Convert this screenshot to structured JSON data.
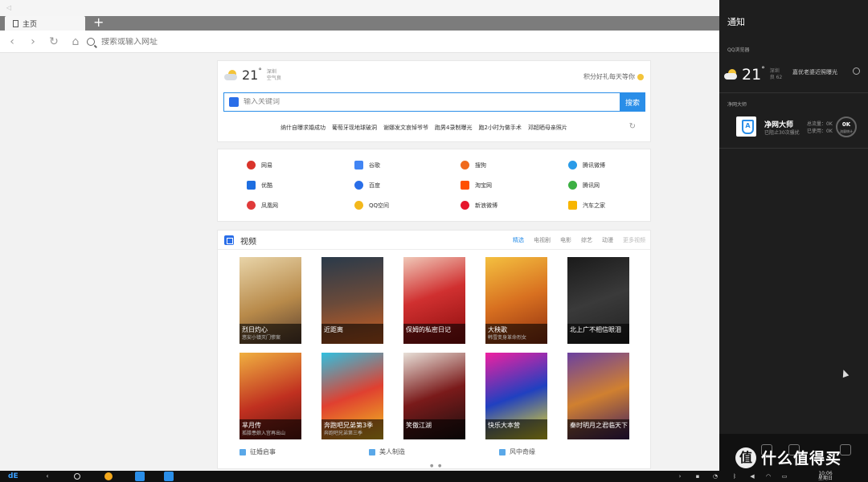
{
  "browser": {
    "tab_label": "主页",
    "new_tab": "+",
    "address_placeholder": "搜索或输入网址"
  },
  "search_card": {
    "weather": {
      "temp": "21",
      "deg": "°",
      "city": "深圳",
      "air": "空气良"
    },
    "reward": "积分好礼每天等你",
    "search_placeholder": "输入关键词",
    "search_button": "搜索",
    "hot_words": [
      "纳什自曝求婚成功",
      "葡萄牙现地球破洞",
      "谢娜发文哀悼爷爷",
      "跑男4录制曝光",
      "跑2小时为做手术",
      "邓超晒母亲照片"
    ]
  },
  "sites": [
    [
      "网易",
      "谷歌",
      "搜狗",
      "腾讯微博"
    ],
    [
      "优酷",
      "百度",
      "淘宝网",
      "腾讯网"
    ],
    [
      "凤凰网",
      "QQ空间",
      "新浪微博",
      "汽车之家"
    ]
  ],
  "video": {
    "title": "视频",
    "tabs": [
      "精选",
      "电视剧",
      "电影",
      "综艺",
      "动漫",
      "更多视频"
    ],
    "posters": [
      {
        "title": "烈日灼心",
        "sub": "悠安小镇灭门惨案"
      },
      {
        "title": "近距离",
        "sub": ""
      },
      {
        "title": "保姆的私密日记",
        "sub": ""
      },
      {
        "title": "大秧歌",
        "sub": "韩雪变身革命烈女"
      },
      {
        "title": "北上广不相信眼泪",
        "sub": ""
      },
      {
        "title": "芈月传",
        "sub": "孤膝患娘入宫再出山"
      },
      {
        "title": "奔跑吧兄弟第3季",
        "sub": "奔跑吧兄弟第三季"
      },
      {
        "title": "笑傲江湖",
        "sub": ""
      },
      {
        "title": "快乐大本营",
        "sub": ""
      },
      {
        "title": "秦时明月之君临天下",
        "sub": ""
      }
    ],
    "links": [
      "征婚启事",
      "美人制造",
      "风中奇缘"
    ],
    "pager": "● ●"
  },
  "panel": {
    "title": "通知",
    "section_browser": "QQ浏览器",
    "weather": {
      "temp": "21",
      "deg": "°",
      "city": "深圳",
      "air": "良 62"
    },
    "news": "嘉优老婆近照曝光",
    "section_master": "净网大师",
    "master_name": "净网大师",
    "master_sub": "已阻止30次骚扰",
    "total_flow": "总流量：0K",
    "used_flow": "已使用：0K",
    "speed_value": "0K",
    "speed_label": "流量统计"
  },
  "watermark": {
    "logo": "值",
    "text": "什么值得买"
  },
  "taskbar": {
    "start": "dE",
    "back": "‹",
    "time": "10:06",
    "weekday": "星期日"
  }
}
